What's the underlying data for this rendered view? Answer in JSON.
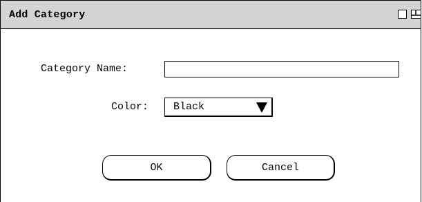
{
  "window": {
    "title": "Add Category",
    "minimize_icon": "window-minimize-icon",
    "maximize_icon": "window-restore-icon"
  },
  "form": {
    "category_name_label": "Category Name:",
    "category_name_value": "",
    "color_label": "Color:",
    "color_value": "Black",
    "color_dropdown_icon": "triangle-down-icon"
  },
  "buttons": {
    "ok_label": "OK",
    "cancel_label": "Cancel"
  }
}
